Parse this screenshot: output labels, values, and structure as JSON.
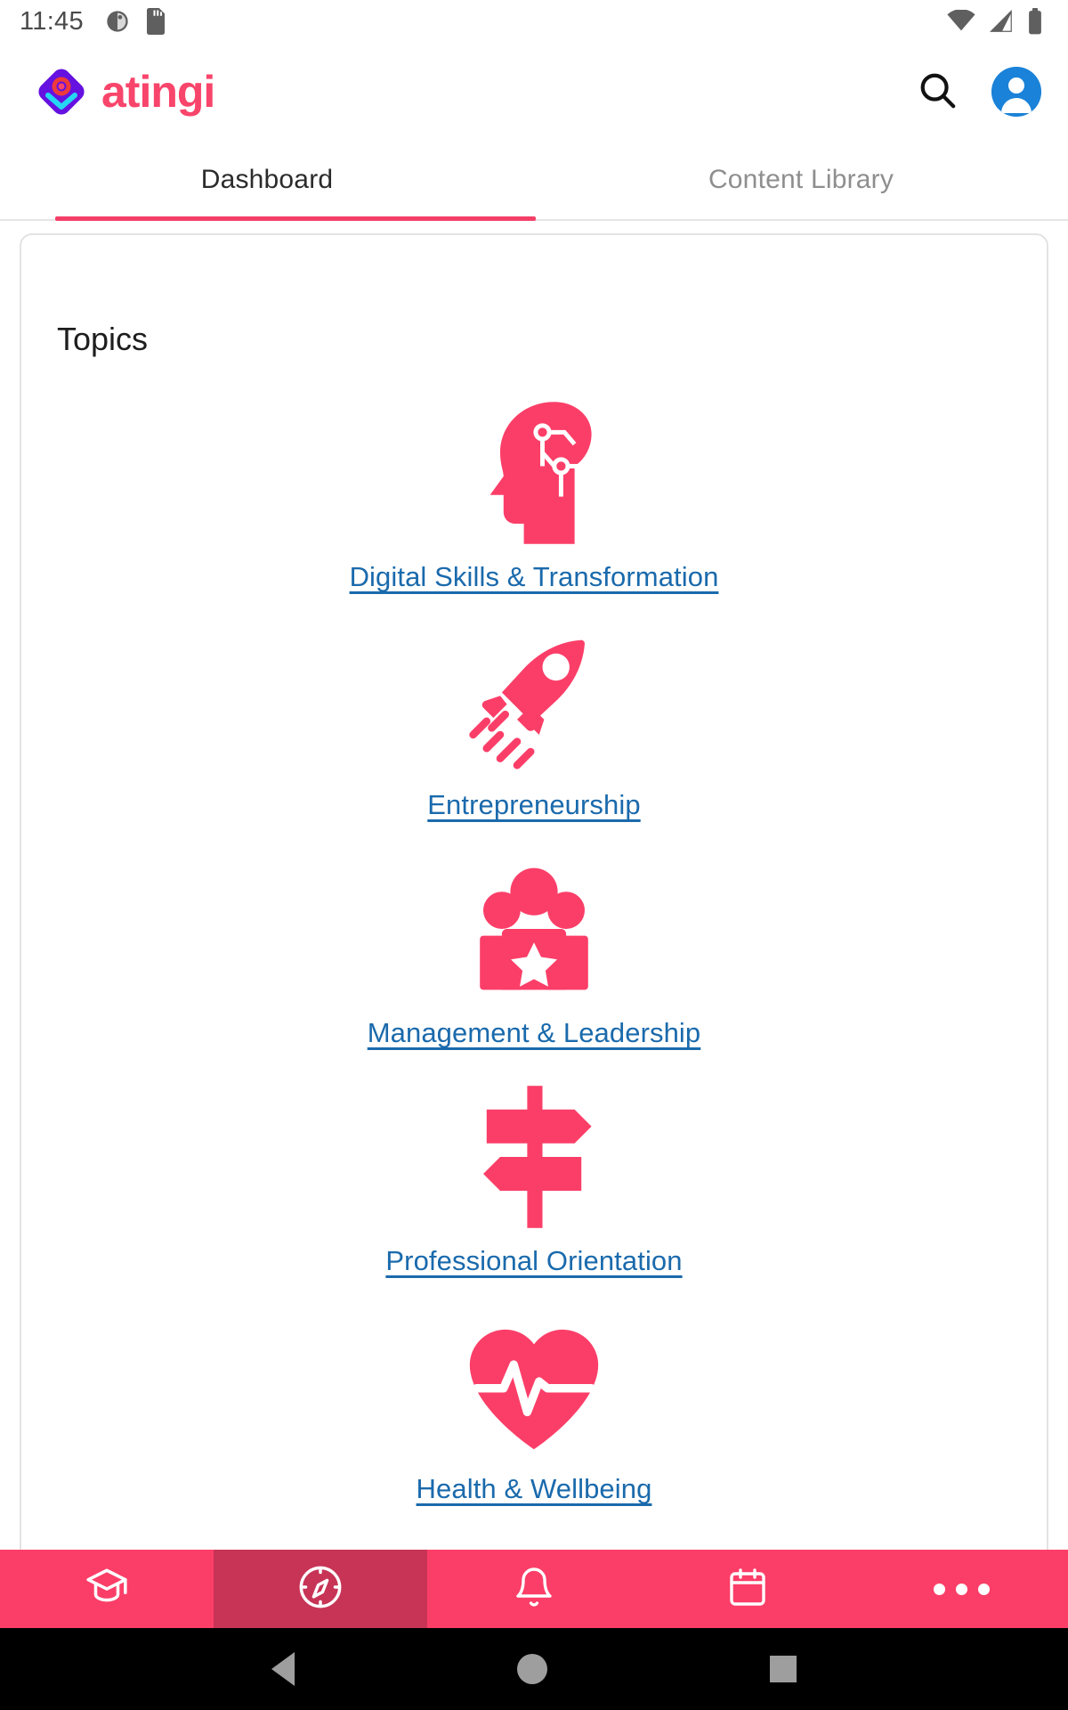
{
  "status_bar": {
    "time": "11:45",
    "left_icons": [
      "contrast-icon",
      "sd-card-icon"
    ],
    "right_icons": [
      "wifi-icon",
      "cellular-signal-icon",
      "battery-icon"
    ]
  },
  "app_bar": {
    "brand_name": "atingi",
    "brand_mark": "atingi-logo-icon",
    "search_icon": "search-icon",
    "account_icon": "account-avatar-icon"
  },
  "tabs": {
    "items": [
      {
        "label": "Dashboard",
        "active": true
      },
      {
        "label": "Content Library",
        "active": false
      }
    ],
    "indicator_color": "#f43f68"
  },
  "main": {
    "card_title": "Topics",
    "topics": [
      {
        "label": "Digital Skills & Transformation",
        "icon": "head-circuit-icon"
      },
      {
        "label": "Entrepreneurship",
        "icon": "rocket-icon"
      },
      {
        "label": "Management & Leadership",
        "icon": "people-star-icon"
      },
      {
        "label": "Professional Orientation",
        "icon": "signpost-icon"
      },
      {
        "label": "Health & Wellbeing",
        "icon": "heart-pulse-icon"
      }
    ],
    "icon_color": "#fb3e68",
    "link_color": "#1a6aac"
  },
  "bottom_nav": {
    "background": "#fb3e68",
    "active_background": "#c73456",
    "items": [
      {
        "icon": "graduation-cap-icon",
        "active": false
      },
      {
        "icon": "compass-icon",
        "active": true
      },
      {
        "icon": "bell-icon",
        "active": false
      },
      {
        "icon": "calendar-icon",
        "active": false
      },
      {
        "icon": "more-dots-icon",
        "active": false
      }
    ]
  },
  "system_nav": {
    "items": [
      "back-icon",
      "home-icon",
      "recents-icon"
    ]
  }
}
